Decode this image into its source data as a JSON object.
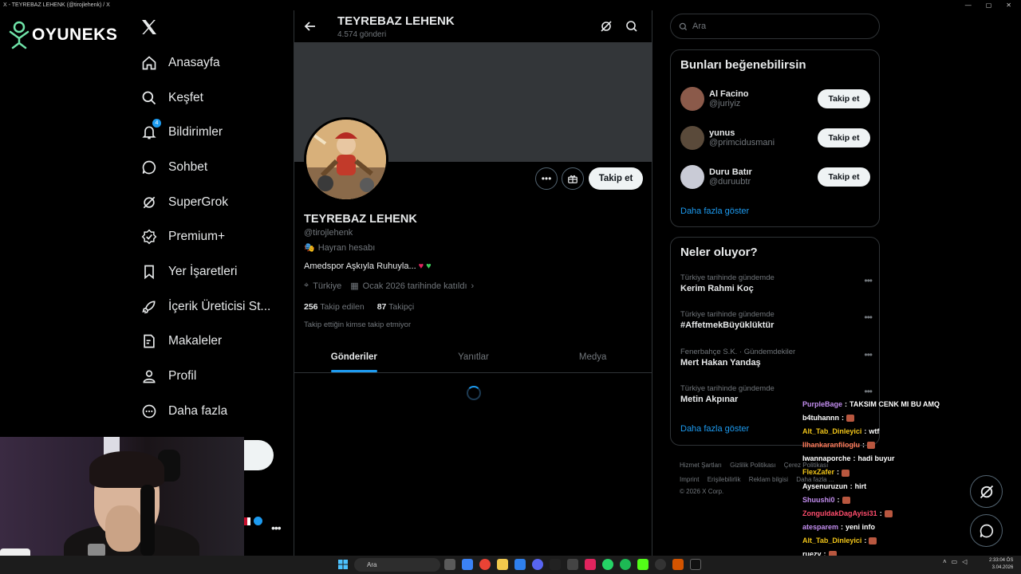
{
  "window": {
    "title": "X - TEYREBAZ LEHENK (@tirojlehenk) / X"
  },
  "brand": {
    "logo_text": "OYUNEKS"
  },
  "nav": {
    "items": [
      {
        "label": "Anasayfa",
        "icon": "home-icon"
      },
      {
        "label": "Keşfet",
        "icon": "search-icon"
      },
      {
        "label": "Bildirimler",
        "icon": "bell-icon",
        "badge": "4"
      },
      {
        "label": "Sohbet",
        "icon": "chat-icon"
      },
      {
        "label": "SuperGrok",
        "icon": "grok-icon"
      },
      {
        "label": "Premium+",
        "icon": "premium-icon"
      },
      {
        "label": "Yer İşaretleri",
        "icon": "bookmark-icon"
      },
      {
        "label": "İçerik Üreticisi St...",
        "icon": "rocket-icon"
      },
      {
        "label": "Makaleler",
        "icon": "article-icon"
      },
      {
        "label": "Profil",
        "icon": "person-icon"
      },
      {
        "label": "Daha fazla",
        "icon": "more-circle-icon"
      }
    ]
  },
  "header": {
    "title": "TEYREBAZ LEHENK",
    "post_count": "4.574 gönderi"
  },
  "profile": {
    "name": "TEYREBAZ LEHENK",
    "handle": "@tirojlehenk",
    "account_type": "Hayran hesabı",
    "bio": "Amedspor Aşkıyla Ruhuyla...",
    "location": "Türkiye",
    "joined": "Ocak 2026 tarihinde katıldı",
    "following_count": "256",
    "following_label": "Takip edilen",
    "followers_count": "87",
    "followers_label": "Takipçi",
    "mutual_note": "Takip ettiğin kimse takip etmiyor",
    "follow_label": "Takip et"
  },
  "tabs": [
    "Gönderiler",
    "Yanıtlar",
    "Medya"
  ],
  "search": {
    "placeholder": "Ara"
  },
  "suggestions": {
    "title": "Bunları beğenebilirsin",
    "users": [
      {
        "name": "Al Facino",
        "handle": "@juriyiz",
        "color": "#8b5a4a"
      },
      {
        "name": "yunus",
        "handle": "@primcidusmani",
        "color": "#5a4a3a"
      },
      {
        "name": "Duru Batır",
        "handle": "@duruubtr",
        "color": "#c9cbd6"
      }
    ],
    "follow_label": "Takip et",
    "show_more": "Daha fazla göster"
  },
  "trends": {
    "title": "Neler oluyor?",
    "items": [
      {
        "context": "Türkiye tarihinde gündemde",
        "topic": "Kerim Rahmi Koç"
      },
      {
        "context": "Türkiye tarihinde gündemde",
        "topic": "#AffetmekBüyüklüktür"
      },
      {
        "context": "Fenerbahçe S.K. · Gündemdekiler",
        "topic": "Mert Hakan Yandaş"
      },
      {
        "context": "Türkiye tarihinde gündemde",
        "topic": "Metin Akpınar"
      }
    ],
    "show_more": "Daha fazla göster"
  },
  "footer": {
    "links": [
      "Hizmet Şartları",
      "Gizlilik Politikası",
      "Çerez Politikası",
      "Imprint",
      "Erişilebilirlik",
      "Reklam bilgisi",
      "Daha fazla ..."
    ],
    "copyright": "© 2026 X Corp."
  },
  "chat": [
    {
      "user": "PurpleBage",
      "text": "TAKSIM CENK MI BU AMQ",
      "color": "#c38ef0"
    },
    {
      "user": "b4tuhannn",
      "text": "",
      "color": "#ffffff",
      "emote": true
    },
    {
      "user": "Alt_Tab_Dinleyici",
      "text": "wtf",
      "color": "#f0c419"
    },
    {
      "user": "Ilhankaranfiloglu",
      "text": "",
      "color": "#ff7a59",
      "emote": true
    },
    {
      "user": "Iwannaporche",
      "text": "hadi buyur",
      "color": "#ffffff"
    },
    {
      "user": "FlexZafer",
      "text": "",
      "color": "#f0c419",
      "emote": true
    },
    {
      "user": "Aysenuruzun",
      "text": "hirt",
      "color": "#ffffff"
    },
    {
      "user": "Shuushi0",
      "text": "",
      "color": "#c38ef0",
      "emote": true
    },
    {
      "user": "ZonguldakDagAyisi31",
      "text": "",
      "color": "#ff4d6d",
      "emote": true
    },
    {
      "user": "atesparem",
      "text": "yeni info",
      "color": "#c38ef0"
    },
    {
      "user": "Alt_Tab_Dinleyici",
      "text": "",
      "color": "#f0c419",
      "emote": true
    },
    {
      "user": "ruezy",
      "text": "",
      "color": "#ffffff",
      "emote": true
    }
  ],
  "taskbar": {
    "search_placeholder": "Ara",
    "time": "2:33:04 ÖS",
    "date": "3.04.2026"
  },
  "colors": {
    "accent": "#1d9bf0",
    "background": "#000000",
    "border": "#2f3336",
    "muted": "#71767b"
  }
}
